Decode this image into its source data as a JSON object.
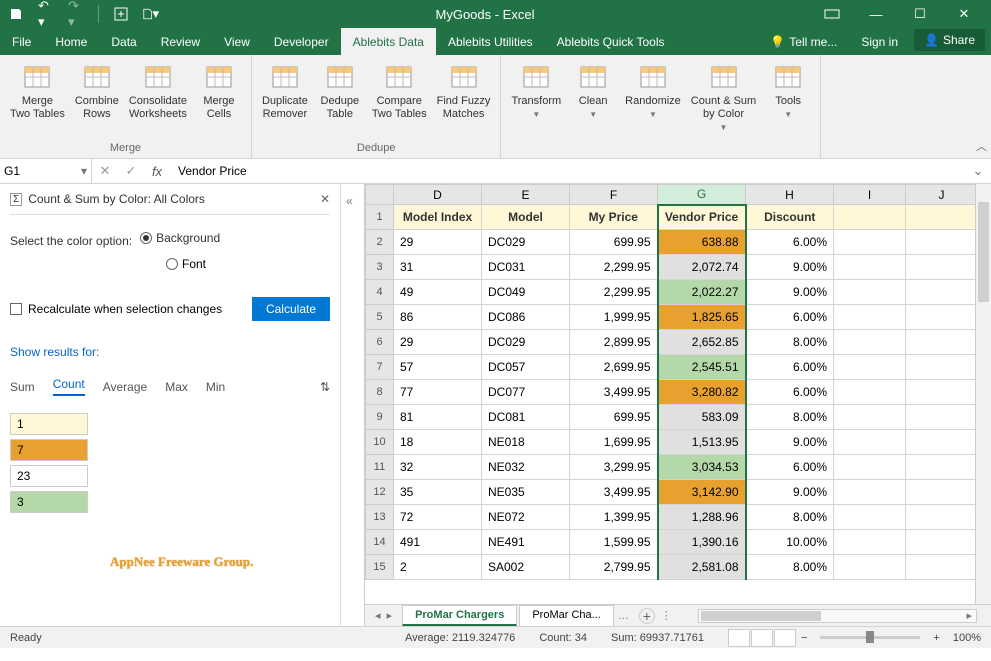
{
  "title": "MyGoods - Excel",
  "tabs": [
    "File",
    "Home",
    "Data",
    "Review",
    "View",
    "Developer",
    "Ablebits Data",
    "Ablebits Utilities",
    "Ablebits Quick Tools"
  ],
  "active_tab": 6,
  "tell_me": "Tell me...",
  "sign_in": "Sign in",
  "share": "Share",
  "ribbon": {
    "groups": [
      {
        "label": "Merge",
        "items": [
          "Merge\nTwo Tables",
          "Combine\nRows",
          "Consolidate\nWorksheets",
          "Merge\nCells"
        ]
      },
      {
        "label": "Dedupe",
        "items": [
          "Duplicate\nRemover",
          "Dedupe\nTable",
          "Compare\nTwo Tables",
          "Find Fuzzy\nMatches"
        ]
      },
      {
        "label": "",
        "items": [
          "Transform",
          "Clean",
          "Randomize",
          "Count & Sum\nby Color",
          "Tools"
        ]
      }
    ]
  },
  "name_box": "G1",
  "formula": "Vendor Price",
  "sidepane": {
    "title": "Count & Sum by Color: All Colors",
    "select_label": "Select the color option:",
    "opt_background": "Background",
    "opt_font": "Font",
    "recalc_label": "Recalculate when selection changes",
    "calculate": "Calculate",
    "show_results": "Show results for:",
    "metrics": [
      "Sum",
      "Count",
      "Average",
      "Max",
      "Min"
    ],
    "active_metric": 1,
    "results": [
      {
        "color": "#fff7d6",
        "value": "1"
      },
      {
        "color": "#e8a12e",
        "value": "7"
      },
      {
        "color": "#ffffff",
        "value": "23"
      },
      {
        "color": "#b5d8a8",
        "value": "3"
      }
    ],
    "watermark": "AppNee Freeware Group."
  },
  "columns": [
    "D",
    "E",
    "F",
    "G",
    "H",
    "I",
    "J"
  ],
  "selected_col": 3,
  "headers": [
    "Model Index",
    "Model",
    "My Price",
    "Vendor Price",
    "Discount"
  ],
  "rows": [
    {
      "n": 2,
      "d": "29",
      "e": "DC029",
      "f": "699.95",
      "g": "638.88",
      "gbg": "orange",
      "h": "6.00%"
    },
    {
      "n": 3,
      "d": "31",
      "e": "DC031",
      "f": "2,299.95",
      "g": "2,072.74",
      "gbg": "gray",
      "h": "9.00%"
    },
    {
      "n": 4,
      "d": "49",
      "e": "DC049",
      "f": "2,299.95",
      "g": "2,022.27",
      "gbg": "green",
      "h": "9.00%"
    },
    {
      "n": 5,
      "d": "86",
      "e": "DC086",
      "f": "1,999.95",
      "g": "1,825.65",
      "gbg": "orange",
      "h": "6.00%"
    },
    {
      "n": 6,
      "d": "29",
      "e": "DC029",
      "f": "2,899.95",
      "g": "2,652.85",
      "gbg": "gray",
      "h": "8.00%"
    },
    {
      "n": 7,
      "d": "57",
      "e": "DC057",
      "f": "2,699.95",
      "g": "2,545.51",
      "gbg": "green",
      "h": "6.00%"
    },
    {
      "n": 8,
      "d": "77",
      "e": "DC077",
      "f": "3,499.95",
      "g": "3,280.82",
      "gbg": "orange",
      "h": "6.00%"
    },
    {
      "n": 9,
      "d": "81",
      "e": "DC081",
      "f": "699.95",
      "g": "583.09",
      "gbg": "gray",
      "h": "8.00%"
    },
    {
      "n": 10,
      "d": "18",
      "e": "NE018",
      "f": "1,699.95",
      "g": "1,513.95",
      "gbg": "gray",
      "h": "9.00%"
    },
    {
      "n": 11,
      "d": "32",
      "e": "NE032",
      "f": "3,299.95",
      "g": "3,034.53",
      "gbg": "green",
      "h": "6.00%"
    },
    {
      "n": 12,
      "d": "35",
      "e": "NE035",
      "f": "3,499.95",
      "g": "3,142.90",
      "gbg": "orange",
      "h": "9.00%"
    },
    {
      "n": 13,
      "d": "72",
      "e": "NE072",
      "f": "1,399.95",
      "g": "1,288.96",
      "gbg": "gray",
      "h": "8.00%"
    },
    {
      "n": 14,
      "d": "491",
      "e": "NE491",
      "f": "1,599.95",
      "g": "1,390.16",
      "gbg": "gray",
      "h": "10.00%"
    },
    {
      "n": 15,
      "d": "2",
      "e": "SA002",
      "f": "2,799.95",
      "g": "2,581.08",
      "gbg": "gray",
      "h": "8.00%"
    }
  ],
  "sheets": [
    "ProMar Chargers",
    "ProMar Cha..."
  ],
  "active_sheet": 0,
  "status": {
    "ready": "Ready",
    "average": "Average: 2119.324776",
    "count": "Count: 34",
    "sum": "Sum: 69937.71761",
    "zoom": "100%"
  }
}
